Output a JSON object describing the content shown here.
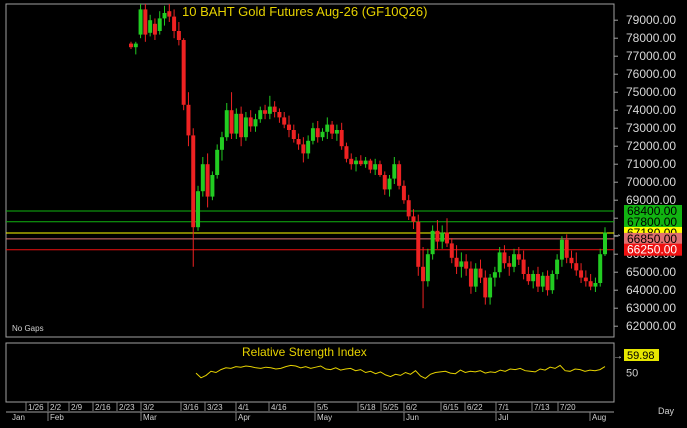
{
  "chart_data": [
    {
      "type": "candlestick",
      "title": "10 BAHT  Gold  Futures  Aug-26  (GF10Q26)",
      "note": "No Gaps",
      "ylim": [
        61400,
        79900
      ],
      "y_ticks": [
        62000,
        63000,
        64000,
        65000,
        66000,
        67000,
        68000,
        69000,
        70000,
        71000,
        72000,
        73000,
        74000,
        75000,
        76000,
        77000,
        78000,
        79000
      ],
      "y_tick_labels": [
        "62000.00",
        "63000.00",
        "64000.00",
        "65000.00",
        "66000.00",
        "67000.00",
        "68000.00",
        "69000.00",
        "70000.00",
        "71000.00",
        "72000.00",
        "73000.00",
        "74000.00",
        "75000.00",
        "76000.00",
        "77000.00",
        "78000.00",
        "79000.00"
      ],
      "x_labels_top": [
        "1/26",
        "2/2",
        "2/9",
        "2/16",
        "2/23",
        "3/2",
        "3/16",
        "3/23",
        "4/1",
        "4/16",
        "5/5",
        "5/18",
        "5/25",
        "6/2",
        "6/15",
        "6/22",
        "7/1",
        "7/13",
        "7/20"
      ],
      "x_labels_bottom": [
        "Jan",
        "Feb",
        "Mar",
        "Apr",
        "May",
        "Jun",
        "Jul",
        "Aug"
      ],
      "period_label": "Day",
      "levels": [
        {
          "value": 68400,
          "label": "68400.00",
          "color": "#11b311",
          "text": "#000000"
        },
        {
          "value": 67800,
          "label": "67800.00",
          "color": "#11b311",
          "text": "#000000"
        },
        {
          "value": 67180,
          "label": "67180.00",
          "color": "#ffff00",
          "text": "#000000"
        },
        {
          "value": 66850,
          "label": "66850.00",
          "color": "#e07070",
          "text": "#000000"
        },
        {
          "value": 66250,
          "label": "66250.00",
          "color": "#ee1111",
          "text": "#ffffff"
        }
      ],
      "up_color": "#22cc22",
      "down_color": "#ee2222",
      "candles": [
        {
          "o": 77700,
          "h": 77800,
          "l": 77400,
          "c": 77500
        },
        {
          "o": 77500,
          "h": 77800,
          "l": 77100,
          "c": 77700
        },
        {
          "o": 78200,
          "h": 79900,
          "l": 78000,
          "c": 79600
        },
        {
          "o": 79600,
          "h": 79900,
          "l": 77800,
          "c": 78200
        },
        {
          "o": 78300,
          "h": 79300,
          "l": 78100,
          "c": 79000
        },
        {
          "o": 78800,
          "h": 79100,
          "l": 77900,
          "c": 78200
        },
        {
          "o": 78400,
          "h": 79500,
          "l": 78200,
          "c": 79100
        },
        {
          "o": 79100,
          "h": 79800,
          "l": 78700,
          "c": 79400
        },
        {
          "o": 79500,
          "h": 79900,
          "l": 78900,
          "c": 79200
        },
        {
          "o": 79200,
          "h": 79600,
          "l": 78000,
          "c": 78400
        },
        {
          "o": 78400,
          "h": 78900,
          "l": 77600,
          "c": 77900
        },
        {
          "o": 77900,
          "h": 78000,
          "l": 74000,
          "c": 74300
        },
        {
          "o": 74300,
          "h": 75000,
          "l": 72000,
          "c": 72600
        },
        {
          "o": 72600,
          "h": 73000,
          "l": 65300,
          "c": 67500
        },
        {
          "o": 67500,
          "h": 69800,
          "l": 67300,
          "c": 69500
        },
        {
          "o": 69500,
          "h": 71400,
          "l": 69200,
          "c": 71000
        },
        {
          "o": 71000,
          "h": 71600,
          "l": 68600,
          "c": 69200
        },
        {
          "o": 69200,
          "h": 70600,
          "l": 69000,
          "c": 70400
        },
        {
          "o": 70400,
          "h": 72100,
          "l": 70200,
          "c": 71800
        },
        {
          "o": 71800,
          "h": 72800,
          "l": 71200,
          "c": 72500
        },
        {
          "o": 72500,
          "h": 74400,
          "l": 72300,
          "c": 74000
        },
        {
          "o": 74000,
          "h": 75000,
          "l": 72400,
          "c": 72700
        },
        {
          "o": 72700,
          "h": 74100,
          "l": 72400,
          "c": 73800
        },
        {
          "o": 73800,
          "h": 74200,
          "l": 72000,
          "c": 72500
        },
        {
          "o": 72500,
          "h": 73900,
          "l": 72300,
          "c": 73600
        },
        {
          "o": 73600,
          "h": 74000,
          "l": 72800,
          "c": 73100
        },
        {
          "o": 73100,
          "h": 73800,
          "l": 72800,
          "c": 73500
        },
        {
          "o": 73500,
          "h": 74200,
          "l": 73300,
          "c": 74000
        },
        {
          "o": 74000,
          "h": 74300,
          "l": 73500,
          "c": 73800
        },
        {
          "o": 73800,
          "h": 74800,
          "l": 73500,
          "c": 74200
        },
        {
          "o": 74200,
          "h": 74500,
          "l": 73600,
          "c": 73900
        },
        {
          "o": 73900,
          "h": 74100,
          "l": 73300,
          "c": 73600
        },
        {
          "o": 73600,
          "h": 73900,
          "l": 73000,
          "c": 73200
        },
        {
          "o": 73200,
          "h": 73700,
          "l": 72500,
          "c": 72900
        },
        {
          "o": 72900,
          "h": 73200,
          "l": 72200,
          "c": 72400
        },
        {
          "o": 72400,
          "h": 72700,
          "l": 71800,
          "c": 72100
        },
        {
          "o": 72100,
          "h": 72500,
          "l": 71100,
          "c": 71600
        },
        {
          "o": 71600,
          "h": 72600,
          "l": 71300,
          "c": 72300
        },
        {
          "o": 72300,
          "h": 73300,
          "l": 72100,
          "c": 73000
        },
        {
          "o": 73000,
          "h": 73400,
          "l": 72200,
          "c": 72500
        },
        {
          "o": 72500,
          "h": 73000,
          "l": 72300,
          "c": 72800
        },
        {
          "o": 72800,
          "h": 73600,
          "l": 72400,
          "c": 73200
        },
        {
          "o": 73200,
          "h": 73400,
          "l": 72400,
          "c": 72700
        },
        {
          "o": 72700,
          "h": 73200,
          "l": 72300,
          "c": 72900
        },
        {
          "o": 72900,
          "h": 73300,
          "l": 71800,
          "c": 72000
        },
        {
          "o": 72000,
          "h": 72200,
          "l": 71100,
          "c": 71300
        },
        {
          "o": 71300,
          "h": 71600,
          "l": 70700,
          "c": 71000
        },
        {
          "o": 71000,
          "h": 71400,
          "l": 70600,
          "c": 71200
        },
        {
          "o": 71200,
          "h": 71500,
          "l": 70900,
          "c": 71000
        },
        {
          "o": 71000,
          "h": 71400,
          "l": 70800,
          "c": 71200
        },
        {
          "o": 71200,
          "h": 71300,
          "l": 70500,
          "c": 70700
        },
        {
          "o": 70700,
          "h": 71300,
          "l": 70400,
          "c": 71000
        },
        {
          "o": 71000,
          "h": 71200,
          "l": 70300,
          "c": 70400
        },
        {
          "o": 70400,
          "h": 70600,
          "l": 69300,
          "c": 69600
        },
        {
          "o": 69600,
          "h": 70400,
          "l": 69200,
          "c": 70200
        },
        {
          "o": 70200,
          "h": 71400,
          "l": 69900,
          "c": 71000
        },
        {
          "o": 71000,
          "h": 71200,
          "l": 69600,
          "c": 69800
        },
        {
          "o": 69800,
          "h": 70100,
          "l": 68800,
          "c": 69000
        },
        {
          "o": 69000,
          "h": 69300,
          "l": 67900,
          "c": 68100
        },
        {
          "o": 68100,
          "h": 68500,
          "l": 67400,
          "c": 67800
        },
        {
          "o": 67800,
          "h": 68200,
          "l": 64800,
          "c": 65300
        },
        {
          "o": 65300,
          "h": 66400,
          "l": 63000,
          "c": 64500
        },
        {
          "o": 64500,
          "h": 66300,
          "l": 64200,
          "c": 66000
        },
        {
          "o": 66000,
          "h": 67600,
          "l": 65700,
          "c": 67300
        },
        {
          "o": 67300,
          "h": 67900,
          "l": 66300,
          "c": 66700
        },
        {
          "o": 66700,
          "h": 67600,
          "l": 66300,
          "c": 67200
        },
        {
          "o": 67200,
          "h": 68000,
          "l": 66400,
          "c": 66600
        },
        {
          "o": 66600,
          "h": 66900,
          "l": 65500,
          "c": 65800
        },
        {
          "o": 65800,
          "h": 66500,
          "l": 64900,
          "c": 65300
        },
        {
          "o": 65300,
          "h": 66100,
          "l": 64700,
          "c": 65600
        },
        {
          "o": 65600,
          "h": 66000,
          "l": 64800,
          "c": 65200
        },
        {
          "o": 65200,
          "h": 65600,
          "l": 63800,
          "c": 64200
        },
        {
          "o": 64200,
          "h": 65500,
          "l": 63900,
          "c": 65200
        },
        {
          "o": 65200,
          "h": 65700,
          "l": 64400,
          "c": 64700
        },
        {
          "o": 64700,
          "h": 65100,
          "l": 63200,
          "c": 63600
        },
        {
          "o": 63600,
          "h": 64900,
          "l": 63200,
          "c": 64700
        },
        {
          "o": 64700,
          "h": 65300,
          "l": 64200,
          "c": 65000
        },
        {
          "o": 65000,
          "h": 66400,
          "l": 64700,
          "c": 66100
        },
        {
          "o": 66100,
          "h": 66500,
          "l": 65200,
          "c": 65500
        },
        {
          "o": 65500,
          "h": 65900,
          "l": 64800,
          "c": 65300
        },
        {
          "o": 65300,
          "h": 66300,
          "l": 65000,
          "c": 66000
        },
        {
          "o": 66000,
          "h": 66400,
          "l": 65400,
          "c": 65700
        },
        {
          "o": 65700,
          "h": 66200,
          "l": 64600,
          "c": 64900
        },
        {
          "o": 64900,
          "h": 65300,
          "l": 64300,
          "c": 64500
        },
        {
          "o": 64500,
          "h": 65100,
          "l": 64100,
          "c": 64900
        },
        {
          "o": 64900,
          "h": 65300,
          "l": 63900,
          "c": 64200
        },
        {
          "o": 64200,
          "h": 65000,
          "l": 63900,
          "c": 64800
        },
        {
          "o": 64800,
          "h": 65100,
          "l": 63700,
          "c": 64000
        },
        {
          "o": 64000,
          "h": 65100,
          "l": 63800,
          "c": 64900
        },
        {
          "o": 64900,
          "h": 66000,
          "l": 64600,
          "c": 65700
        },
        {
          "o": 65700,
          "h": 67000,
          "l": 65300,
          "c": 66800
        },
        {
          "o": 66800,
          "h": 67100,
          "l": 65500,
          "c": 65800
        },
        {
          "o": 65800,
          "h": 66200,
          "l": 65200,
          "c": 65500
        },
        {
          "o": 65500,
          "h": 66100,
          "l": 64800,
          "c": 65100
        },
        {
          "o": 65100,
          "h": 65500,
          "l": 64400,
          "c": 64700
        },
        {
          "o": 64700,
          "h": 65100,
          "l": 64200,
          "c": 64500
        },
        {
          "o": 64500,
          "h": 64900,
          "l": 64000,
          "c": 64200
        },
        {
          "o": 64200,
          "h": 64700,
          "l": 63900,
          "c": 64400
        },
        {
          "o": 64400,
          "h": 66300,
          "l": 64200,
          "c": 66000
        },
        {
          "o": 66000,
          "h": 67500,
          "l": 65900,
          "c": 67200
        }
      ]
    },
    {
      "type": "line",
      "title": "Relative Strength Index",
      "ylim": [
        0,
        100
      ],
      "y_ticks": [
        50
      ],
      "y_tick_labels": [
        "50"
      ],
      "last_value_label": "59.98",
      "line_color": "#e6d200",
      "values": [
        49,
        41,
        45,
        52,
        50,
        55,
        58,
        57,
        60,
        59,
        61,
        60,
        58,
        57,
        59,
        58,
        56,
        57,
        60,
        62,
        61,
        58,
        60,
        57,
        59,
        61,
        56,
        55,
        58,
        54,
        56,
        57,
        53,
        55,
        50,
        52,
        48,
        51,
        46,
        43,
        47,
        45,
        50,
        47,
        53,
        44,
        40,
        47,
        50,
        51,
        52,
        49,
        48,
        54,
        50,
        52,
        51,
        53,
        49,
        51,
        50,
        54,
        52,
        56,
        55,
        57,
        53,
        52,
        51,
        56,
        54,
        59,
        57,
        62,
        53,
        52,
        56,
        55,
        52,
        54,
        53,
        55,
        60
      ]
    }
  ]
}
